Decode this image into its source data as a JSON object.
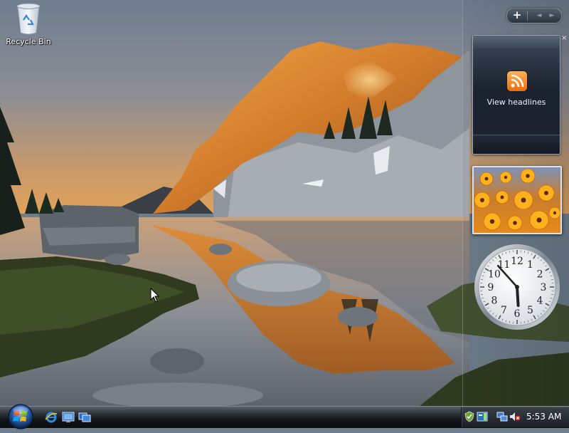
{
  "desktop": {
    "icons": [
      {
        "label": "Recycle Bin",
        "icon": "recycle-bin-icon"
      }
    ]
  },
  "sidebar": {
    "controls": {
      "add_label": "+",
      "prev_label": "◄",
      "next_label": "►"
    },
    "close_label": "×",
    "feed_gadget": {
      "label": "View headlines",
      "icon": "rss-icon"
    },
    "slideshow_gadget": {
      "subject": "orange flowers"
    },
    "clock_gadget": {
      "numerals": [
        "1",
        "2",
        "3",
        "4",
        "5",
        "6",
        "7",
        "8",
        "9",
        "10",
        "11",
        "12"
      ],
      "hour": 5,
      "minute": 53
    }
  },
  "taskbar": {
    "start_icon": "windows-logo-icon",
    "quick_launch": [
      {
        "icon": "internet-explorer-icon"
      },
      {
        "icon": "show-desktop-icon"
      },
      {
        "icon": "switch-windows-icon"
      }
    ],
    "tray": {
      "icons": [
        "windows-defender-icon",
        "windows-sidebar-icon",
        "network-icon",
        "volume-muted-icon"
      ],
      "time": "5:53 AM"
    }
  },
  "colors": {
    "taskbar": "#121519",
    "rss_orange": "#f08a1c",
    "gadget_dark": "#1c2330"
  }
}
